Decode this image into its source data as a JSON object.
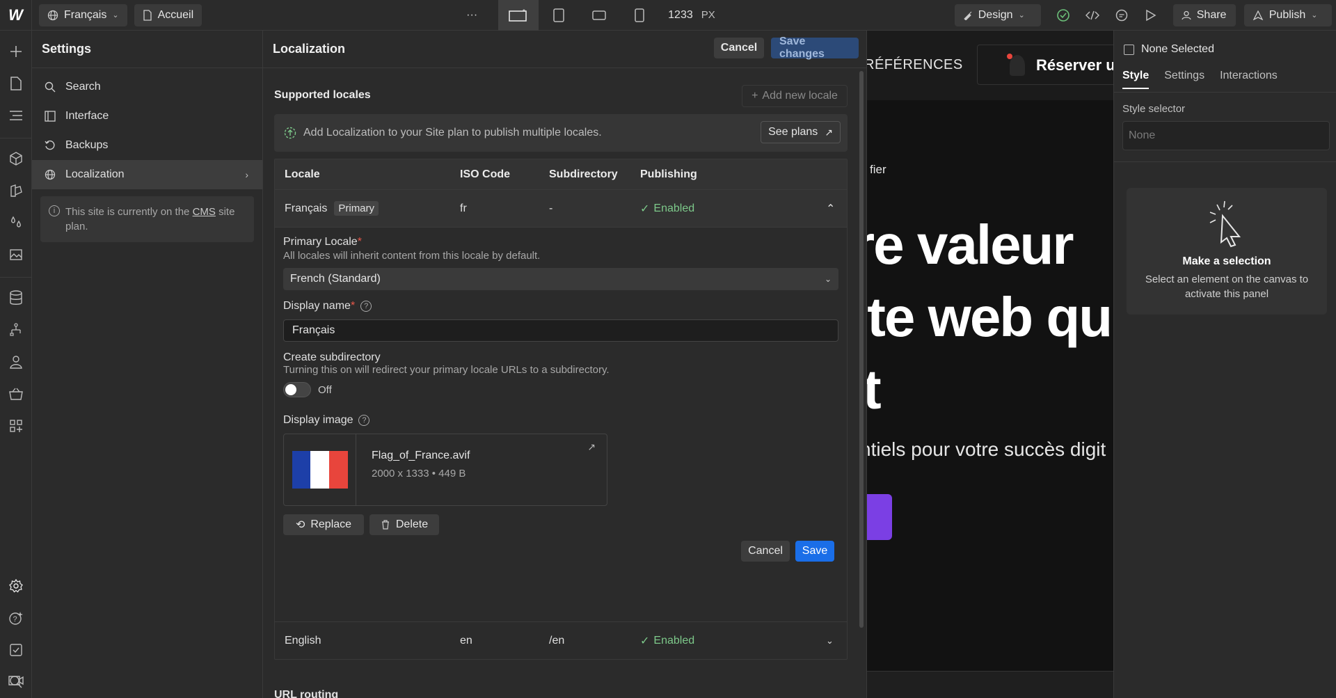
{
  "topbar": {
    "locale": "Français",
    "page": "Accueil",
    "more": "···",
    "width_value": "1233",
    "width_unit": "PX",
    "design": "Design",
    "share": "Share",
    "publish": "Publish"
  },
  "settings": {
    "title": "Settings",
    "items": [
      {
        "label": "Search"
      },
      {
        "label": "Interface"
      },
      {
        "label": "Backups"
      },
      {
        "label": "Localization"
      }
    ],
    "note_before": "This site is currently on the",
    "note_link": "CMS",
    "note_after": "site plan."
  },
  "localization": {
    "title": "Localization",
    "cancel": "Cancel",
    "save_changes": "Save changes",
    "supported_locales": "Supported locales",
    "add_new_locale": "Add new locale",
    "banner_text": "Add Localization to your Site plan to publish multiple locales.",
    "see_plans": "See plans",
    "columns": [
      "Locale",
      "ISO Code",
      "Subdirectory",
      "Publishing"
    ],
    "rows": [
      {
        "locale": "Français",
        "tag": "Primary",
        "iso": "fr",
        "subdir": "-",
        "publishing": "Enabled"
      },
      {
        "locale": "English",
        "iso": "en",
        "subdir": "/en",
        "publishing": "Enabled"
      }
    ],
    "detail": {
      "primary_locale_label": "Primary Locale",
      "primary_locale_desc": "All locales will inherit content from this locale by default.",
      "primary_locale_value": "French (Standard)",
      "display_name_label": "Display name",
      "display_name_value": "Français",
      "subdir_label": "Create subdirectory",
      "subdir_desc": "Turning this on will redirect your primary locale URLs to a subdirectory.",
      "subdir_state": "Off",
      "display_image_label": "Display image",
      "image_name": "Flag_of_France.avif",
      "image_meta": "2000 x 1333 • 449 B",
      "replace": "Replace",
      "delete": "Delete",
      "cancel": "Cancel",
      "save": "Save"
    },
    "next_section": "URL routing"
  },
  "canvas": {
    "nav_text": "RÉFÉRENCES",
    "cta_text": "Réserver u",
    "small_text": "fier",
    "headline_1": "re valeur",
    "headline_2": "ite web qu",
    "headline_3": "t",
    "subline": "ntiels pour votre succès digit",
    "accent": "#7b3fe4"
  },
  "right_panel": {
    "none_selected": "None Selected",
    "tabs": [
      "Style",
      "Settings",
      "Interactions"
    ],
    "style_selector": "Style selector",
    "selector_placeholder": "None",
    "make_selection": "Make a selection",
    "make_selection_desc": "Select an element on the canvas to activate this panel"
  },
  "colors": {
    "accent_blue": "#1a6ee8",
    "enabled_green": "#7dc98a",
    "required_red": "#e8584a",
    "flag_blue": "#1d3fa8",
    "flag_white": "#ffffff",
    "flag_red": "#e8453c"
  }
}
